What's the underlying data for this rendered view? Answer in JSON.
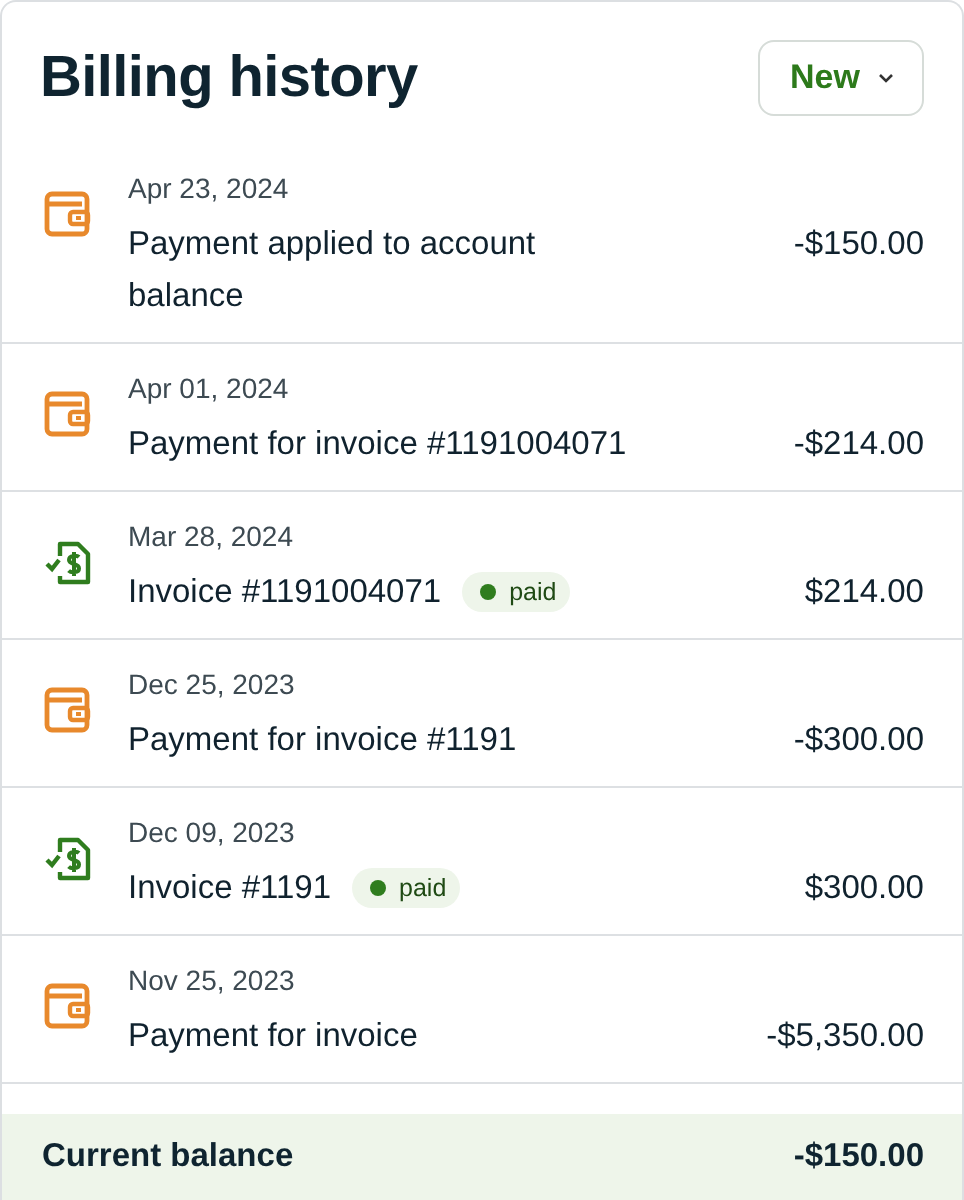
{
  "title": "Billing history",
  "new_button": {
    "label": "New"
  },
  "entries": [
    {
      "kind": "payment",
      "date": "Apr 23, 2024",
      "description": "Payment applied to account balance",
      "amount": "-$150.00"
    },
    {
      "kind": "payment",
      "date": "Apr 01, 2024",
      "description": "Payment for invoice #1191004071",
      "amount": "-$214.00"
    },
    {
      "kind": "invoice",
      "date": "Mar 28, 2024",
      "description": "Invoice #1191004071",
      "badge": "paid",
      "amount": "$214.00"
    },
    {
      "kind": "payment",
      "date": "Dec 25, 2023",
      "description": "Payment for invoice #1191",
      "amount": "-$300.00"
    },
    {
      "kind": "invoice",
      "date": "Dec 09, 2023",
      "description": "Invoice #1191",
      "badge": "paid",
      "amount": "$300.00"
    },
    {
      "kind": "payment",
      "date": "Nov 25, 2023",
      "description": "Payment for invoice",
      "amount": "-$5,350.00"
    }
  ],
  "footer": {
    "label": "Current balance",
    "amount": "-$150.00"
  }
}
